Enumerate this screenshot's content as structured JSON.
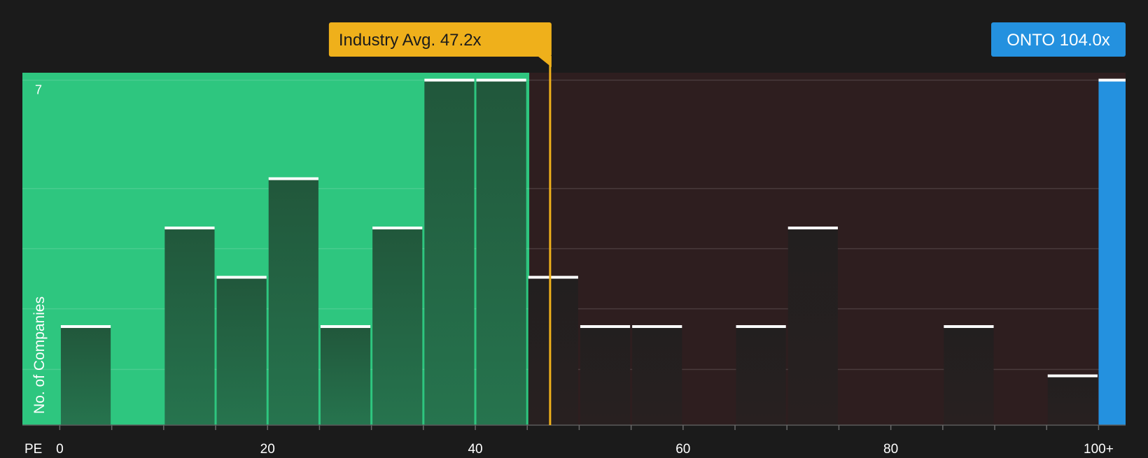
{
  "chart_data": {
    "type": "bar",
    "xlabel": "PE",
    "ylabel": "No. of Companies",
    "x_tick_labels": [
      "0",
      "20",
      "40",
      "60",
      "80",
      "100+"
    ],
    "x_ticks": [
      0,
      20,
      40,
      60,
      80,
      100
    ],
    "xlim": [
      -3.6,
      102.6
    ],
    "ylim": [
      0,
      7.15
    ],
    "y_tick_labels": [
      "7"
    ],
    "y_ticks": [
      7
    ],
    "grid": true,
    "bin_width": 5,
    "bins": [
      {
        "start": 0,
        "end": 5,
        "count": 2
      },
      {
        "start": 10,
        "end": 15,
        "count": 4
      },
      {
        "start": 15,
        "end": 20,
        "count": 3
      },
      {
        "start": 20,
        "end": 25,
        "count": 5
      },
      {
        "start": 25,
        "end": 30,
        "count": 2
      },
      {
        "start": 30,
        "end": 35,
        "count": 4
      },
      {
        "start": 35,
        "end": 40,
        "count": 7
      },
      {
        "start": 40,
        "end": 45,
        "count": 7
      },
      {
        "start": 45,
        "end": 50,
        "count": 3
      },
      {
        "start": 50,
        "end": 55,
        "count": 2
      },
      {
        "start": 55,
        "end": 60,
        "count": 2
      },
      {
        "start": 65,
        "end": 70,
        "count": 2
      },
      {
        "start": 70,
        "end": 75,
        "count": 4
      },
      {
        "start": 85,
        "end": 90,
        "count": 2
      },
      {
        "start": 95,
        "end": 100,
        "count": 1
      }
    ],
    "industry_avg": {
      "label": "Industry Avg. 47.2x",
      "value": 47.2
    },
    "fair_region_end": 45.2,
    "company": {
      "label": "ONTO 104.0x",
      "value": 104.0,
      "count": 7
    },
    "colors": {
      "background": "#1b1b1b",
      "undervalued_region": "#2ec67f",
      "overvalued_region": "#2e1e1f",
      "bar_in_green": "#21573b",
      "bar_in_red": "#221f1f",
      "bar_cap": "#ffffff",
      "industry_avg": "#efb01b",
      "company": "#2491df",
      "axis_text": "#ffffff",
      "gridline": "#ffffff"
    }
  }
}
